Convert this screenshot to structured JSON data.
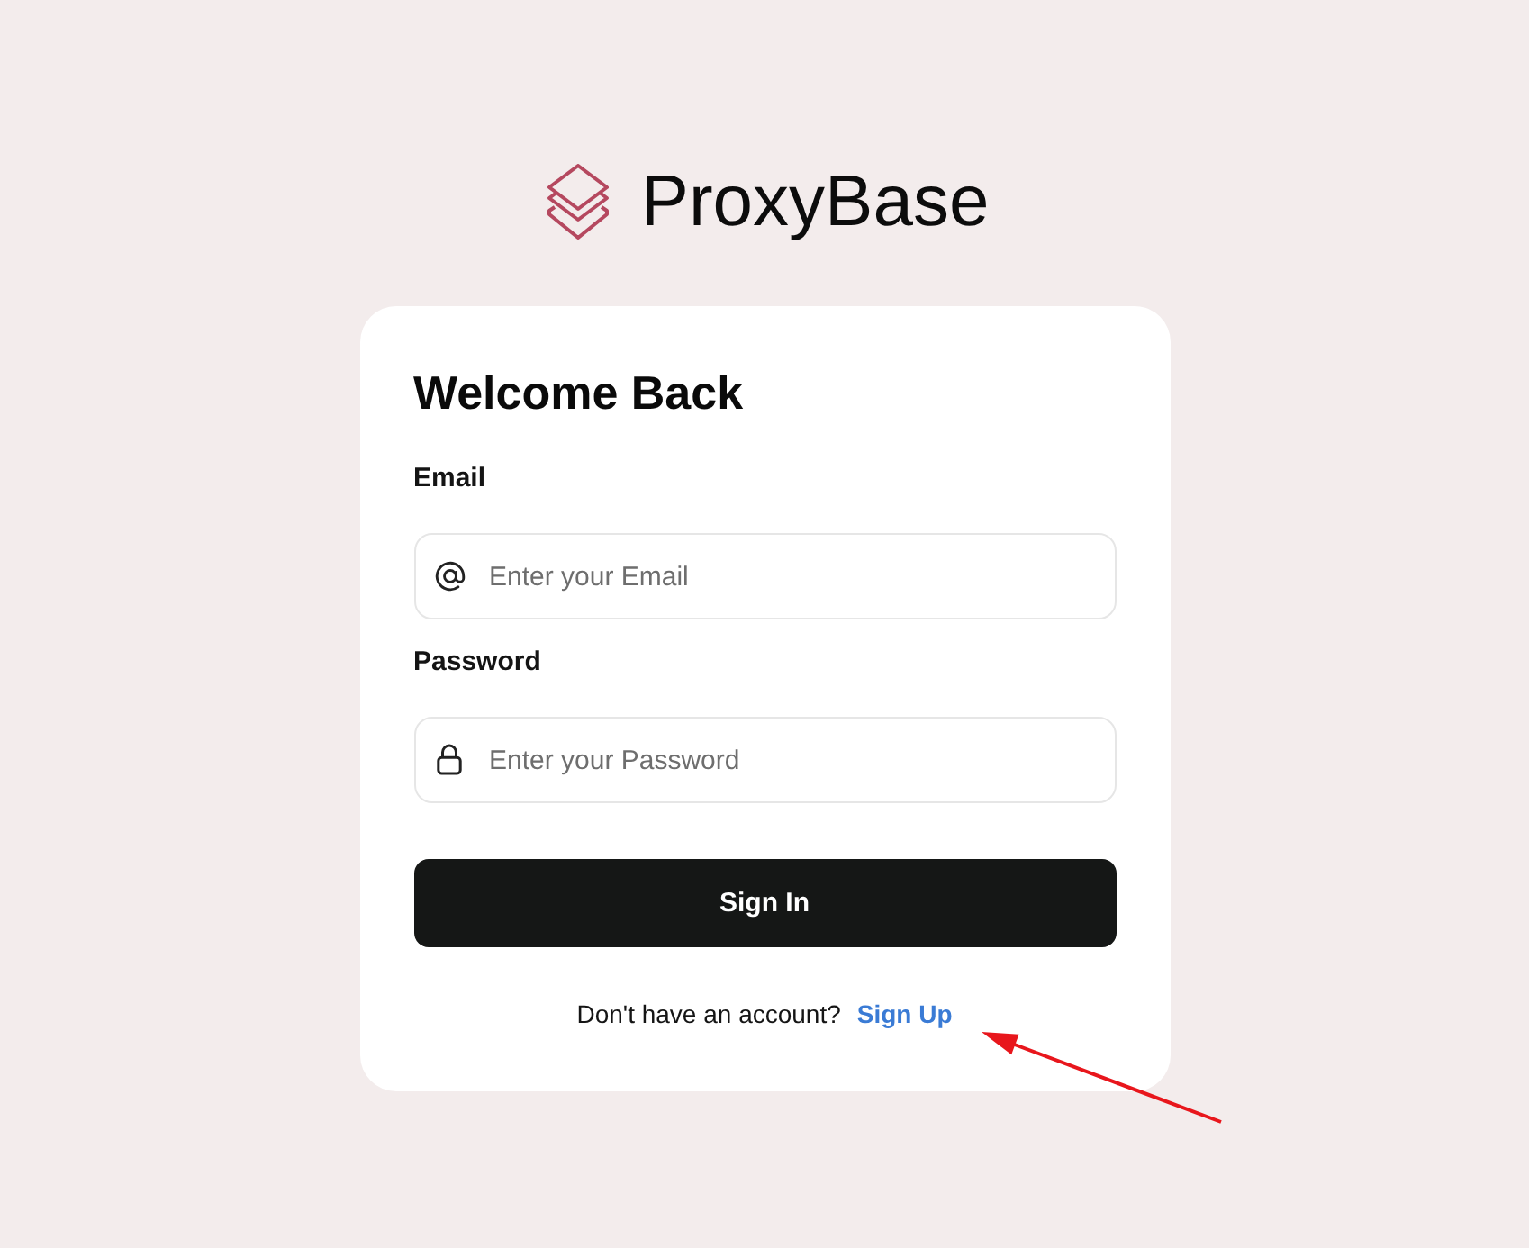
{
  "brand": {
    "name": "ProxyBase"
  },
  "form": {
    "title": "Welcome Back",
    "fields": [
      {
        "kind": "email",
        "label": "Email",
        "placeholder": "Enter your Email"
      },
      {
        "kind": "password",
        "label": "Password",
        "placeholder": "Enter your Password"
      }
    ],
    "submit": "Sign In",
    "footer": {
      "prompt": "Don't have an account?",
      "link": "Sign Up"
    }
  }
}
